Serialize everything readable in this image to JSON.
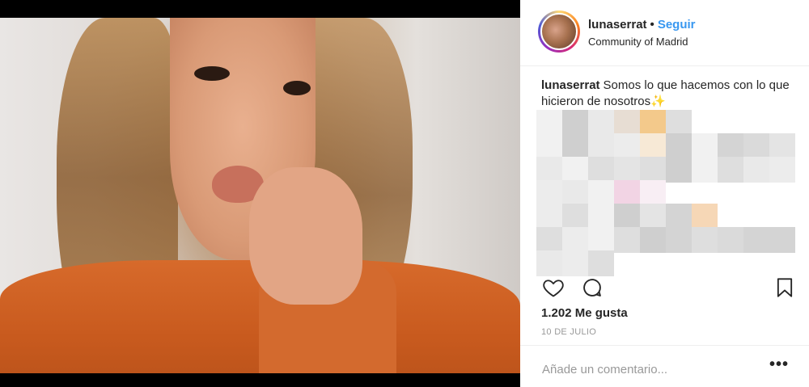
{
  "post": {
    "username": "lunaserrat",
    "separator": "•",
    "follow_label": "Seguir",
    "location": "Community of Madrid",
    "caption_user": "lunaserrat",
    "caption_text": "Somos lo que hacemos con lo que hicieron de nosotros",
    "caption_emoji": "✨",
    "likes": "1.202 Me gusta",
    "date": "10 DE JULIO",
    "comment_placeholder": "Añade un comentario...",
    "more_label": "•••"
  },
  "icons": {
    "like": "heart-icon",
    "comment": "comment-icon",
    "save": "bookmark-icon",
    "options": "more-options-icon"
  },
  "colors": {
    "link_blue": "#3897f0",
    "text": "#262626",
    "muted": "#999999",
    "divider": "#efefef"
  }
}
